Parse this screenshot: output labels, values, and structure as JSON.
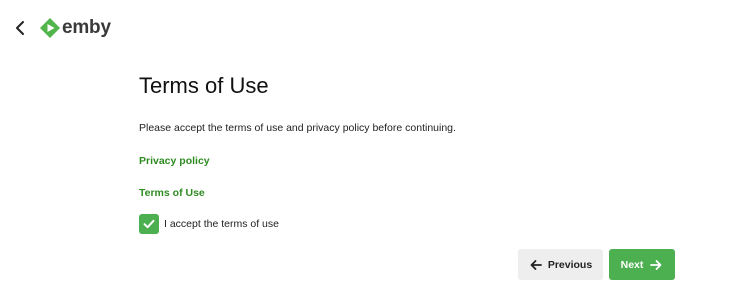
{
  "header": {
    "logo_text": "emby",
    "back_icon": "chevron-left-icon",
    "logo_icon": "emby-logo-icon"
  },
  "main": {
    "title": "Terms of Use",
    "description": "Please accept the terms of use and privacy policy before continuing.",
    "privacy_link": "Privacy policy",
    "terms_link": "Terms of Use",
    "accept_checkbox": {
      "label": "I accept the terms of use",
      "checked": true
    }
  },
  "footer": {
    "previous_label": "Previous",
    "previous_icon": "arrow-left-icon",
    "next_label": "Next",
    "next_icon": "arrow-right-icon"
  },
  "colors": {
    "accent": "#4caf50",
    "link": "#2e8b22",
    "button_secondary": "#eeeeee"
  }
}
